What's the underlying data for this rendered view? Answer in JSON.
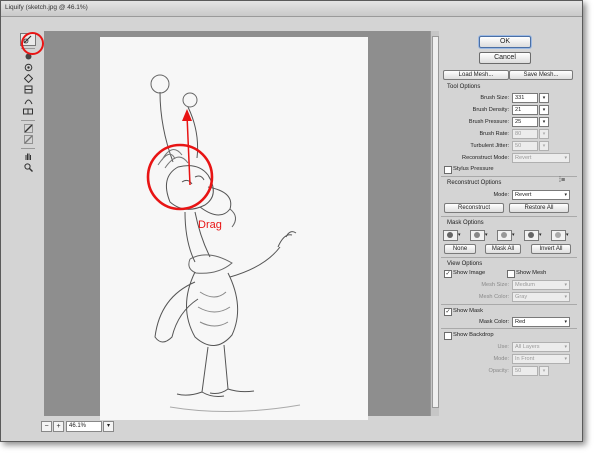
{
  "window": {
    "title": "Liquify (sketch.jpg @ 46.1%)"
  },
  "tools": [
    "forward-warp",
    "reconstruct",
    "twirl-clockwise",
    "pucker",
    "bloat",
    "push-left",
    "mirror",
    "turbulence",
    "freeze-mask",
    "thaw-mask",
    "hand",
    "zoom"
  ],
  "canvas": {
    "annotation": "Drag",
    "annotation_color": "#e81414"
  },
  "status": {
    "zoom": "46.1%",
    "minus": "−",
    "plus": "+"
  },
  "panel": {
    "ok": "OK",
    "cancel": "Cancel",
    "load_mesh": "Load Mesh...",
    "save_mesh": "Save Mesh...",
    "tool_options": {
      "title": "Tool Options",
      "brush_size_label": "Brush Size:",
      "brush_size": "331",
      "brush_density_label": "Brush Density:",
      "brush_density": "21",
      "brush_pressure_label": "Brush Pressure:",
      "brush_pressure": "25",
      "brush_rate_label": "Brush Rate:",
      "brush_rate": "80",
      "turbulent_jitter_label": "Turbulent Jitter:",
      "turbulent_jitter": "50",
      "reconstruct_mode_label": "Reconstruct Mode:",
      "reconstruct_mode": "Revert",
      "stylus_pressure": "Stylus Pressure"
    },
    "reconstruct_options": {
      "title": "Reconstruct Options",
      "mode_label": "Mode:",
      "mode": "Revert",
      "reconstruct": "Reconstruct",
      "restore_all": "Restore All"
    },
    "mask_options": {
      "title": "Mask Options",
      "none": "None",
      "mask_all": "Mask All",
      "invert_all": "Invert All"
    },
    "view_options": {
      "title": "View Options",
      "show_image": "Show Image",
      "show_image_checked": true,
      "show_mesh": "Show Mesh",
      "show_mesh_checked": false,
      "mesh_size_label": "Mesh Size:",
      "mesh_size": "Medium",
      "mesh_color_label": "Mesh Color:",
      "mesh_color": "Gray",
      "show_mask": "Show Mask",
      "show_mask_checked": true,
      "mask_color_label": "Mask Color:",
      "mask_color": "Red",
      "show_backdrop": "Show Backdrop",
      "show_backdrop_checked": false,
      "use_label": "Use:",
      "use": "All Layers",
      "mode_label": "Mode:",
      "mode": "In Front",
      "opacity_label": "Opacity:",
      "opacity": "50"
    }
  }
}
